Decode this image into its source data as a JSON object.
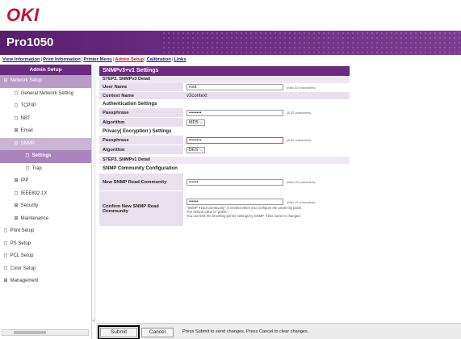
{
  "brand": {
    "logo": "OKI",
    "model": "Pro1050",
    "accent": "#6b2a80",
    "logo_color": "#c8102e"
  },
  "topnav": {
    "links": [
      "View Information",
      "Print Information",
      "Printer Menu",
      "Admin Setup",
      "Calibration",
      "Links"
    ],
    "active": "Admin Setup"
  },
  "sidebar": {
    "title": "Admin Setup",
    "items": [
      {
        "label": "Network Setup",
        "icon": "minus-box-icon",
        "icon_glyph": "⊟"
      },
      {
        "label": "General Network Setting",
        "icon": "page-icon",
        "icon_glyph": "◻"
      },
      {
        "label": "TCP/IP",
        "icon": "page-icon",
        "icon_glyph": "◻"
      },
      {
        "label": "NBT",
        "icon": "page-icon",
        "icon_glyph": "◻"
      },
      {
        "label": "Email",
        "icon": "plus-box-icon",
        "icon_glyph": "⊞"
      },
      {
        "label": "SNMP",
        "icon": "minus-box-icon",
        "icon_glyph": "⊟"
      },
      {
        "label": "Settings",
        "icon": "page-icon",
        "icon_glyph": "◻"
      },
      {
        "label": "Trap",
        "icon": "page-icon",
        "icon_glyph": "◻"
      },
      {
        "label": "IPP",
        "icon": "plus-box-icon",
        "icon_glyph": "⊞"
      },
      {
        "label": "IEEE802.1X",
        "icon": "page-icon",
        "icon_glyph": "◻"
      },
      {
        "label": "Security",
        "icon": "plus-box-icon",
        "icon_glyph": "⊞"
      },
      {
        "label": "Maintenance",
        "icon": "plus-box-icon",
        "icon_glyph": "⊞"
      },
      {
        "label": "Print Setup",
        "icon": "page-icon",
        "icon_glyph": "◻"
      },
      {
        "label": "PS Setup",
        "icon": "page-icon",
        "icon_glyph": "◻"
      },
      {
        "label": "PCL Setup",
        "icon": "page-icon",
        "icon_glyph": "◻"
      },
      {
        "label": "Color Setup",
        "icon": "page-icon",
        "icon_glyph": "◻"
      },
      {
        "label": "Management",
        "icon": "plus-box-icon",
        "icon_glyph": "⊞"
      }
    ]
  },
  "main": {
    "title": "SNMPv3+v1 Settings",
    "step2": "STEP2.  SNMPv3 Detail",
    "user_name": {
      "label": "User Name",
      "value": "root",
      "hint": "(Max.32 characters)"
    },
    "context_name": {
      "label": "Context Name",
      "value": "v3context"
    },
    "auth_heading": "Authentication Settings",
    "auth_pass": {
      "label": "Passphrase",
      "value": "••••••••",
      "hint": "(8-32 characters)"
    },
    "auth_algo": {
      "label": "Algorithm",
      "value": "MD5"
    },
    "priv_heading": "Privacy( Encryption ) Settings",
    "priv_pass": {
      "label": "Passphrase",
      "value": "••••••••",
      "hint": "(8-32 characters)"
    },
    "priv_algo": {
      "label": "Algorithm",
      "value": "DES"
    },
    "step3": "STEP3.  SNMPv1 Detail",
    "comm_heading": "SNMP Community Configuration",
    "new_read": {
      "label": "New SNMP Read Community",
      "value": "••••••",
      "hint": "(Max.15 characters)"
    },
    "confirm_read": {
      "label": "Confirm New SNMP Read Community",
      "value": "••••••",
      "hint": "(Max.15 characters)"
    },
    "note1": "\"SNMP Read Community\" is needed when you configure the printer by panel.",
    "note2": "The default value is \"public\".",
    "note3": "You can limit the browsing printer settings by SNMP, if this name is changed."
  },
  "footer": {
    "submit": "Submit",
    "cancel": "Cancel",
    "message": "Press Submit to send changes. Press Cancel to clear changes."
  }
}
